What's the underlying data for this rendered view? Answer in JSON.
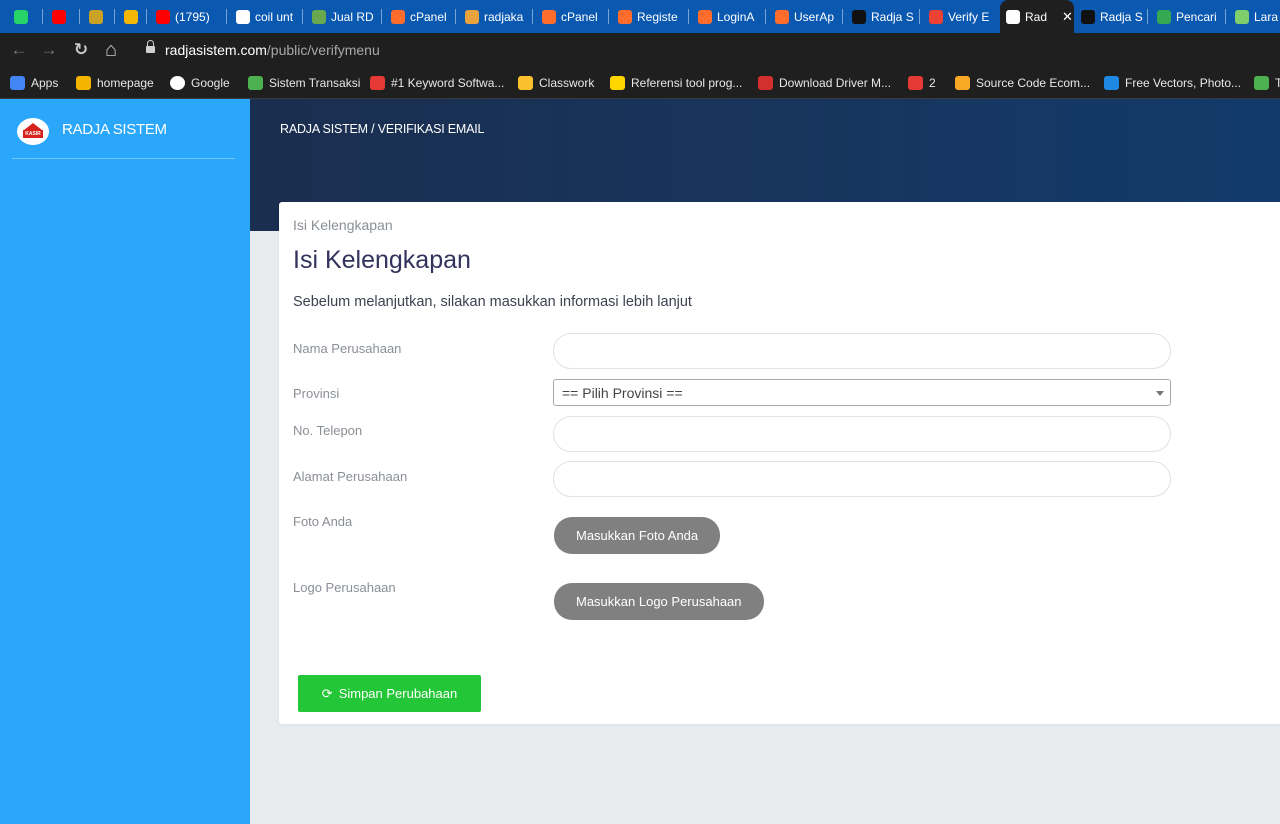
{
  "browser": {
    "tabs": [
      {
        "label": "",
        "favicon": "whatsapp-icon",
        "color": "#25d366"
      },
      {
        "label": "",
        "favicon": "youtube-icon",
        "color": "#ff0000"
      },
      {
        "label": "",
        "favicon": "garuda-icon",
        "color": "#c9a227"
      },
      {
        "label": "",
        "favicon": "book-icon",
        "color": "#f2b705"
      },
      {
        "label": "(1795)",
        "favicon": "youtube-icon",
        "color": "#ff0000"
      },
      {
        "label": "coil unt",
        "favicon": "google-icon",
        "color": "#ffffff"
      },
      {
        "label": "Jual RD",
        "favicon": "shop-icon",
        "color": "#6aa84f"
      },
      {
        "label": "cPanel",
        "favicon": "cpanel-icon",
        "color": "#ff6c2c"
      },
      {
        "label": "radjaka",
        "favicon": "temple-icon",
        "color": "#e8a33d"
      },
      {
        "label": "cPanel",
        "favicon": "cpanel-icon",
        "color": "#ff6c2c"
      },
      {
        "label": "Registe",
        "favicon": "cpanel-icon",
        "color": "#ff6c2c"
      },
      {
        "label": "LoginA",
        "favicon": "cpanel-icon",
        "color": "#ff6c2c"
      },
      {
        "label": "UserAp",
        "favicon": "cpanel-icon",
        "color": "#ff6c2c"
      },
      {
        "label": "Radja S",
        "favicon": "bow-icon",
        "color": "#111111"
      },
      {
        "label": "Verify E",
        "favicon": "gmail-icon",
        "color": "#ea4335"
      },
      {
        "label": "Rad",
        "favicon": "bow-icon",
        "color": "#ffffff"
      },
      {
        "label": "Radja S",
        "favicon": "bow-icon",
        "color": "#111111"
      },
      {
        "label": "Pencari",
        "favicon": "pencil-icon",
        "color": "#34a853"
      },
      {
        "label": "Lara",
        "favicon": "note-icon",
        "color": "#7ecf6b"
      }
    ],
    "active_tab_close": "✕",
    "nav": {
      "back": "←",
      "forward": "→",
      "reload": "↻",
      "home": "⌂"
    },
    "url_host": "radjasistem.com",
    "url_path": "/public/verifymenu",
    "bookmarks": [
      {
        "label": "Apps",
        "favicon": "apps-grid-icon",
        "color": "#4285f4"
      },
      {
        "label": "homepage",
        "favicon": "homepage-icon",
        "color": "#f4b400"
      },
      {
        "label": "Google",
        "favicon": "google-icon",
        "color": "#ffffff"
      },
      {
        "label": "Sistem Transaksi",
        "favicon": "image-icon",
        "color": "#4caf50"
      },
      {
        "label": "#1 Keyword Softwa...",
        "favicon": "keyword-icon",
        "color": "#e53935"
      },
      {
        "label": "Classwork",
        "favicon": "classroom-icon",
        "color": "#fbc02d"
      },
      {
        "label": "Referensi tool prog...",
        "favicon": "reference-icon",
        "color": "#ffd600"
      },
      {
        "label": "Download Driver M...",
        "favicon": "driver-icon",
        "color": "#d32f2f"
      },
      {
        "label": "2",
        "favicon": "bolt-icon",
        "color": "#e53935"
      },
      {
        "label": "Source Code Ecom...",
        "favicon": "graduation-icon",
        "color": "#f9a825"
      },
      {
        "label": "Free Vectors, Photo...",
        "favicon": "freepik-icon",
        "color": "#1e88e5"
      },
      {
        "label": "T",
        "favicon": "w-icon",
        "color": "#4caf50"
      }
    ]
  },
  "sidebar": {
    "brand_name": "RADJA SISTEM",
    "logo_text": "KASIR",
    "accent": "#2aa6fb"
  },
  "header": {
    "breadcrumb": "RADJA SISTEM / VERIFIKASI EMAIL"
  },
  "form": {
    "subtitle": "Isi Kelengkapan",
    "title": "Isi Kelengkapan",
    "description": "Sebelum melanjutkan, silakan masukkan informasi lebih lanjut",
    "fields": {
      "company_name_label": "Nama Perusahaan",
      "province_label": "Provinsi",
      "province_selected": "== Pilih Provinsi ==",
      "phone_label": "No. Telepon",
      "address_label": "Alamat Perusahaan",
      "photo_label": "Foto Anda",
      "photo_button": "Masukkan Foto Anda",
      "logo_label": "Logo Perusahaan",
      "logo_button": "Masukkan Logo Perusahaan"
    },
    "save_button": "Simpan Perubahaan",
    "save_color": "#23c636"
  }
}
